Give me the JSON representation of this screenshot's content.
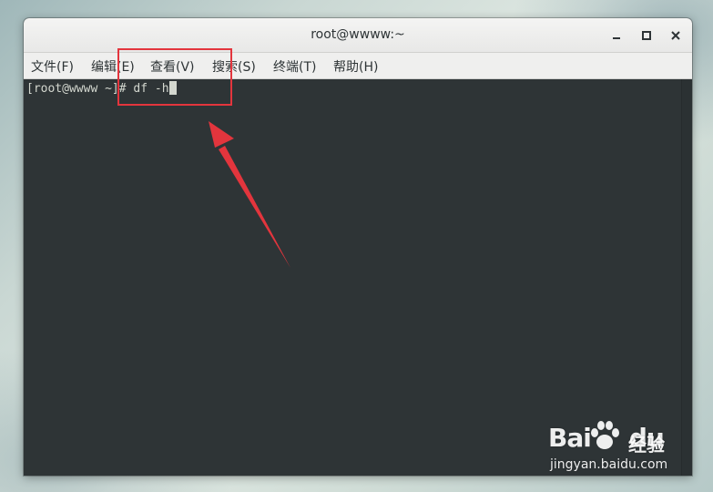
{
  "window": {
    "title": "root@wwww:~",
    "controls": {
      "minimize": "minimize-icon",
      "maximize": "maximize-icon",
      "close": "close-icon"
    }
  },
  "menu": {
    "items": [
      {
        "label": "文件(F)"
      },
      {
        "label": "编辑(E)"
      },
      {
        "label": "查看(V)"
      },
      {
        "label": "搜索(S)"
      },
      {
        "label": "终端(T)"
      },
      {
        "label": "帮助(H)"
      }
    ]
  },
  "terminal": {
    "prompt": "[root@wwww ~]#",
    "command": "df -h"
  },
  "annotation": {
    "box_color": "#e3353d",
    "arrow_color": "#e3353d"
  },
  "watermark": {
    "logo_text": "Bai",
    "logo_suffix": "du",
    "brand_text": "经验",
    "url": "jingyan.baidu.com"
  },
  "colors": {
    "terminal_bg": "#2e3436",
    "terminal_fg": "#d3d7cf",
    "titlebar_bg": "#f0f0ef"
  }
}
